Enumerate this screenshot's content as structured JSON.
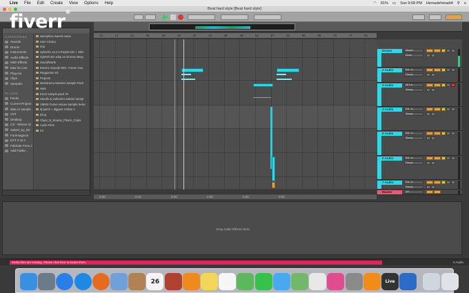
{
  "menubar": {
    "items": [
      "Live",
      "File",
      "Edit",
      "Create",
      "View",
      "Options",
      "Help"
    ],
    "right": [
      "81%",
      "Sun 9:08 PM",
      "Hemadehmadi4"
    ]
  },
  "window": {
    "title": "Beat hard style [Beat hard style]"
  },
  "watermark": {
    "text": "fiverr"
  },
  "browser": {
    "categories_header": "CATEGORIES",
    "categories": [
      "Sounds",
      "Drums",
      "Instruments",
      "Audio Effects",
      "MIDI Effects",
      "Max for Live",
      "Plug-ins",
      "Clips",
      "Samples"
    ],
    "places_header": "PLACES",
    "places": [
      "Packs",
      "Current Project",
      "data or sample",
      "VST",
      "Desktop",
      "CS - Winner IS",
      "Sabert_by_Bri",
      "Foremagazio",
      "EXT 2 v2.1",
      "Fabriate Pons J",
      "Add Folder..."
    ],
    "files": [
      "waveplexe wavele wave",
      "User Library",
      "Imp",
      "Sylenth1 v2.2.0 Purple Kim + Skin",
      "Sylenth sim wisp on Groove Merg",
      "SoundWorls",
      "Electric Sounds WM - Future Hou",
      "Reggaeton Kit",
      "Projects",
      "Melodrama Monster Sample Pack",
      "Hats",
      "KICO sample pack 78",
      "Sandle & Vultress's Sabrini Sampl",
      "VMMS Future House Sample Selec",
      "dj-patch + diggers Hollow 1",
      "Drop",
      "Claps_N_Snares_Pharm_Clubs",
      "Audio Files",
      "Kit"
    ]
  },
  "ruler": {
    "labels": [
      "13",
      "17",
      "21",
      "25",
      "29",
      "33",
      "37",
      "41",
      "45",
      "49",
      "53",
      "57",
      "61",
      "65",
      "69",
      "73",
      "77",
      "81"
    ]
  },
  "bottom_ruler": {
    "labels": [
      "0:00",
      "0:10",
      "0:20",
      "0:30",
      "0:40",
      "0:50"
    ]
  },
  "tracks": [
    {
      "name": "Drums",
      "num": "",
      "sub": "Master",
      "sub2": "None"
    },
    {
      "name": "2 Audio",
      "num": "2",
      "sub": "Ext. In",
      "sub2": "Group"
    },
    {
      "name": "3 Audio",
      "num": "3",
      "sub": "All Ins",
      "sub2": "Group"
    },
    {
      "name": "4 Audio",
      "num": "4",
      "sub": "Ext. In",
      "sub2": "Group"
    },
    {
      "name": "5 Audio",
      "num": "5",
      "sub": "Ext. In",
      "sub2": "Group"
    },
    {
      "name": "6 Audio",
      "num": "6",
      "sub": "Ext. In",
      "sub2": "Group"
    },
    {
      "name": "7 Audio",
      "num": "7",
      "sub": "Ext. In",
      "sub2": "Group"
    },
    {
      "name": "Master",
      "num": "",
      "sub": "1/2",
      "sub2": ""
    }
  ],
  "detail": {
    "drop_hint": "Drop Audio Effects Here"
  },
  "status": {
    "warning": "Media files are missing. Please click here to locate them.",
    "right": "4-Audio"
  },
  "dock": {
    "icons": [
      {
        "name": "finder-icon",
        "color": "#3b8fe0"
      },
      {
        "name": "launchpad-icon",
        "color": "#6c7b8a"
      },
      {
        "name": "app-store-icon",
        "color": "#2a7fe6"
      },
      {
        "name": "safari-icon",
        "color": "#1e88e5"
      },
      {
        "name": "firefox-icon",
        "color": "#e66a20"
      },
      {
        "name": "preview-icon",
        "color": "#6fa0d8"
      },
      {
        "name": "contacts-icon",
        "color": "#b08255"
      },
      {
        "name": "calendar-icon",
        "color": "#f4f4f4"
      },
      {
        "name": "illustrator-icon",
        "color": "#b04030"
      },
      {
        "name": "ibooks-icon",
        "color": "#f08a1d"
      },
      {
        "name": "notes-icon",
        "color": "#f2d65a"
      },
      {
        "name": "reminders-icon",
        "color": "#f6f6f6"
      },
      {
        "name": "charts-icon",
        "color": "#5cb85c"
      },
      {
        "name": "facetime-icon",
        "color": "#36c24a"
      },
      {
        "name": "messages-icon",
        "color": "#4aa8f0"
      },
      {
        "name": "maps-icon",
        "color": "#72b86a"
      },
      {
        "name": "photos-icon",
        "color": "#e8e8e8"
      },
      {
        "name": "itunes-icon",
        "color": "#e04c8f"
      },
      {
        "name": "system-preferences-icon",
        "color": "#8a8a8a"
      },
      {
        "name": "vlc-icon",
        "color": "#f08c1a"
      },
      {
        "name": "ableton-live-icon",
        "color": "#333333"
      },
      {
        "name": "quicktime-icon",
        "color": "#2d6bc9"
      },
      {
        "name": "downloads-icon",
        "color": "#cfd6dd"
      },
      {
        "name": "trash-icon",
        "color": "#dfe3e7"
      }
    ],
    "calendar_day": "26",
    "live_label": "Live"
  }
}
